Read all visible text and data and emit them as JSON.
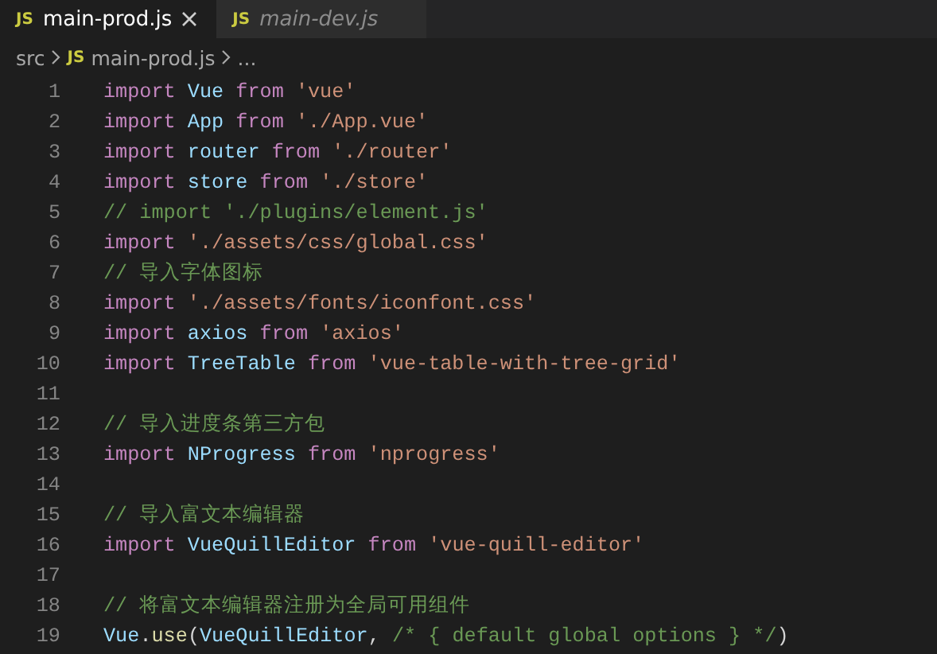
{
  "tabs": [
    {
      "label": "main-prod.js",
      "icon": "JS",
      "selected": true,
      "preview": false,
      "closable": true
    },
    {
      "label": "main-dev.js",
      "icon": "JS",
      "selected": false,
      "preview": true,
      "closable": false
    }
  ],
  "breadcrumb": [
    {
      "kind": "folder",
      "label": "src"
    },
    {
      "kind": "file",
      "icon": "JS",
      "label": "main-prod.js"
    },
    {
      "kind": "more",
      "label": "..."
    }
  ],
  "lines": [
    {
      "number": "1",
      "tokens": [
        {
          "t": "import ",
          "kind": "keyword"
        },
        {
          "t": "Vue ",
          "kind": "ident"
        },
        {
          "t": "from ",
          "kind": "keyword"
        },
        {
          "t": "'vue'",
          "kind": "string"
        }
      ]
    },
    {
      "number": "2",
      "tokens": [
        {
          "t": "import ",
          "kind": "keyword"
        },
        {
          "t": "App ",
          "kind": "ident"
        },
        {
          "t": "from ",
          "kind": "keyword"
        },
        {
          "t": "'./App.vue'",
          "kind": "string"
        }
      ]
    },
    {
      "number": "3",
      "tokens": [
        {
          "t": "import ",
          "kind": "keyword"
        },
        {
          "t": "router ",
          "kind": "ident"
        },
        {
          "t": "from ",
          "kind": "keyword"
        },
        {
          "t": "'./router'",
          "kind": "string"
        }
      ]
    },
    {
      "number": "4",
      "tokens": [
        {
          "t": "import ",
          "kind": "keyword"
        },
        {
          "t": "store ",
          "kind": "ident"
        },
        {
          "t": "from ",
          "kind": "keyword"
        },
        {
          "t": "'./store'",
          "kind": "string"
        }
      ]
    },
    {
      "number": "5",
      "tokens": [
        {
          "t": "// import './plugins/element.js'",
          "kind": "comment"
        }
      ]
    },
    {
      "number": "6",
      "tokens": [
        {
          "t": "import ",
          "kind": "keyword"
        },
        {
          "t": "'./assets/css/global.css'",
          "kind": "string"
        }
      ]
    },
    {
      "number": "7",
      "tokens": [
        {
          "t": "// 导入字体图标",
          "kind": "comment"
        }
      ]
    },
    {
      "number": "8",
      "tokens": [
        {
          "t": "import ",
          "kind": "keyword"
        },
        {
          "t": "'./assets/fonts/iconfont.css'",
          "kind": "string"
        }
      ]
    },
    {
      "number": "9",
      "tokens": [
        {
          "t": "import ",
          "kind": "keyword"
        },
        {
          "t": "axios ",
          "kind": "ident"
        },
        {
          "t": "from ",
          "kind": "keyword"
        },
        {
          "t": "'axios'",
          "kind": "string"
        }
      ]
    },
    {
      "number": "10",
      "tokens": [
        {
          "t": "import ",
          "kind": "keyword"
        },
        {
          "t": "TreeTable ",
          "kind": "ident"
        },
        {
          "t": "from ",
          "kind": "keyword"
        },
        {
          "t": "'vue-table-with-tree-grid'",
          "kind": "string"
        }
      ]
    },
    {
      "number": "11"
    },
    {
      "number": "12",
      "tokens": [
        {
          "t": "// 导入进度条第三方包",
          "kind": "comment"
        }
      ]
    },
    {
      "number": "13",
      "tokens": [
        {
          "t": "import ",
          "kind": "keyword"
        },
        {
          "t": "NProgress ",
          "kind": "ident"
        },
        {
          "t": "from ",
          "kind": "keyword"
        },
        {
          "t": "'nprogress'",
          "kind": "string"
        }
      ]
    },
    {
      "number": "14"
    },
    {
      "number": "15",
      "tokens": [
        {
          "t": "// 导入富文本编辑器",
          "kind": "comment"
        }
      ]
    },
    {
      "number": "16",
      "tokens": [
        {
          "t": "import ",
          "kind": "keyword"
        },
        {
          "t": "VueQuillEditor ",
          "kind": "ident"
        },
        {
          "t": "from ",
          "kind": "keyword"
        },
        {
          "t": "'vue-quill-editor'",
          "kind": "string"
        }
      ]
    },
    {
      "number": "17"
    },
    {
      "number": "18",
      "tokens": [
        {
          "t": "// 将富文本编辑器注册为全局可用组件",
          "kind": "comment"
        }
      ]
    },
    {
      "number": "19",
      "tokens": [
        {
          "t": "Vue",
          "kind": "ident"
        },
        {
          "t": ".",
          "kind": "punct"
        },
        {
          "t": "use",
          "kind": "func"
        },
        {
          "t": "(",
          "kind": "punct"
        },
        {
          "t": "VueQuillEditor",
          "kind": "ident"
        },
        {
          "t": ", ",
          "kind": "punct"
        },
        {
          "t": "/* { default global options } */",
          "kind": "comment"
        },
        {
          "t": ")",
          "kind": "punct"
        }
      ]
    }
  ]
}
